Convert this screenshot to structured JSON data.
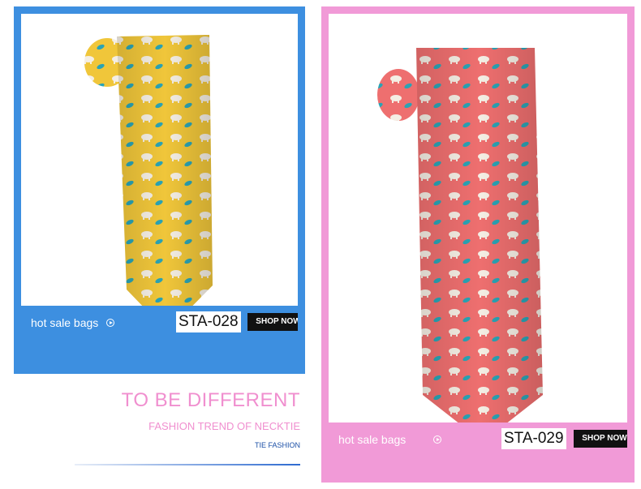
{
  "cards": [
    {
      "theme": "yellow",
      "frame_color": "#3d8fe0",
      "tie_color": "#f0c63a",
      "hot_label": "hot sale bags",
      "code": "STA-028",
      "shop_label": "SHOP NOW"
    },
    {
      "theme": "pink",
      "frame_color": "#f19ad7",
      "tie_color": "#ee6f6f",
      "hot_label": "hot sale bags",
      "code": "STA-029",
      "shop_label": "SHOP NOW"
    }
  ],
  "tagline": {
    "title": "TO BE DIFFERENT",
    "subtitle": "FASHION TREND OF NECKTIE",
    "small": "TIE FASHION"
  },
  "colors": {
    "pink_text": "#f08fcf",
    "blue_text": "#1b4fa6",
    "pattern_white": "#f4eee4",
    "pattern_teal": "#2aa3b4"
  }
}
